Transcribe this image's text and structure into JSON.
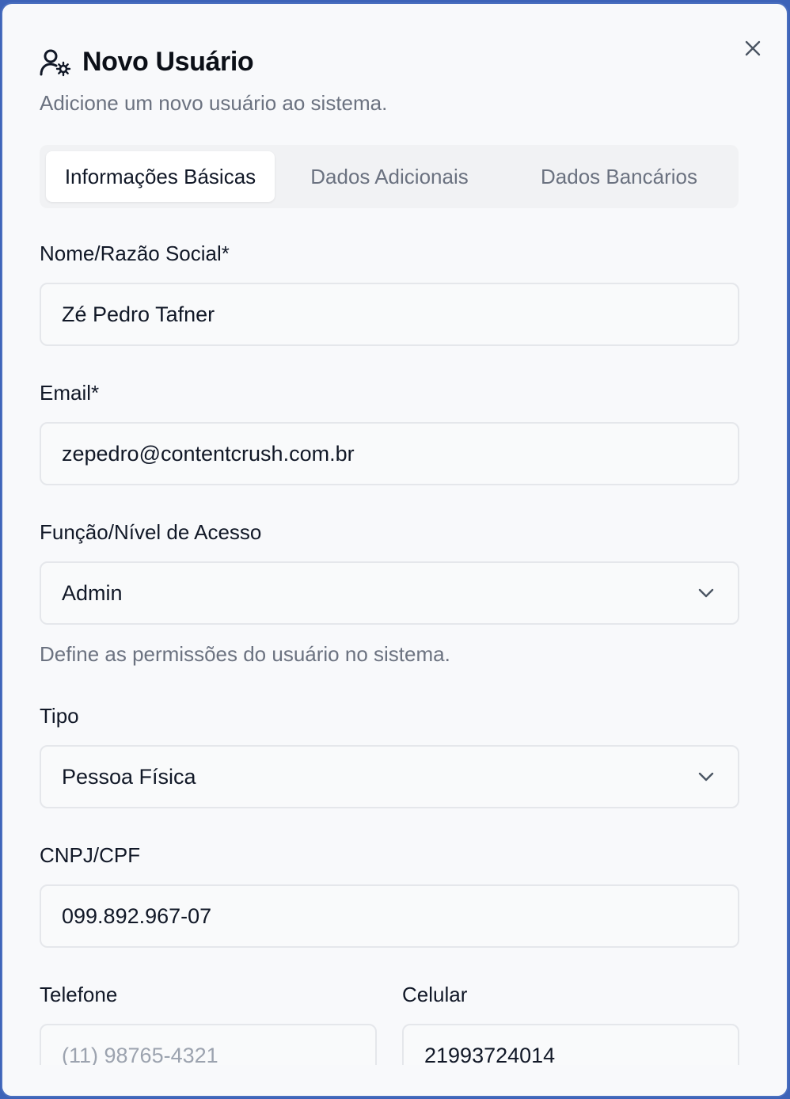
{
  "dialog": {
    "title": "Novo Usuário",
    "subtitle": "Adicione um novo usuário ao sistema.",
    "header_icon": "user-cog-icon",
    "close_icon": "close-icon"
  },
  "tabs": [
    {
      "label": "Informações Básicas",
      "active": true
    },
    {
      "label": "Dados Adicionais",
      "active": false
    },
    {
      "label": "Dados Bancários",
      "active": false
    }
  ],
  "form": {
    "name": {
      "label": "Nome/Razão Social*",
      "value": "Zé Pedro Tafner"
    },
    "email": {
      "label": "Email*",
      "value": "zepedro@contentcrush.com.br"
    },
    "role": {
      "label": "Função/Nível de Acesso",
      "value": "Admin",
      "help": "Define as permissões do usuário no sistema."
    },
    "type": {
      "label": "Tipo",
      "value": "Pessoa Física"
    },
    "document": {
      "label": "CNPJ/CPF",
      "value": "099.892.967-07"
    },
    "phone": {
      "label": "Telefone",
      "value": "",
      "placeholder": "(11) 98765-4321"
    },
    "mobile": {
      "label": "Celular",
      "value": "21993724014"
    }
  },
  "colors": {
    "frame_border": "#4a6fbf",
    "background": "#f8f9fb",
    "muted_text": "#6b7280"
  }
}
